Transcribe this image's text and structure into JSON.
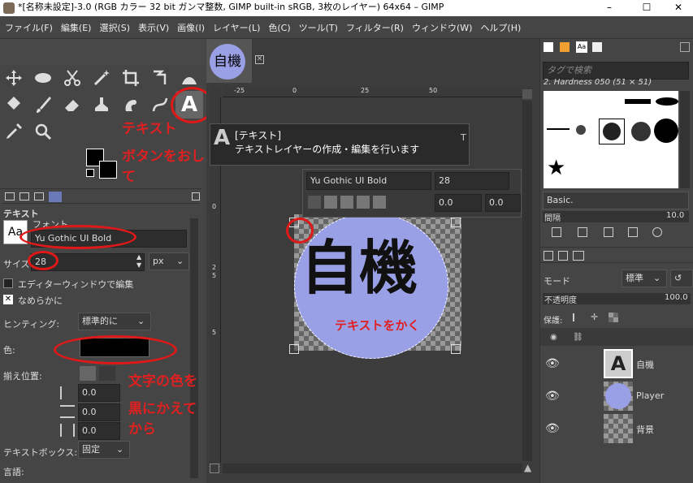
{
  "window": {
    "title": "*[名称未設定]-3.0 (RGB カラー 32 bit ガンマ整数, GIMP built-in sRGB, 3枚のレイヤー) 64x64 – GIMP",
    "minimize": "–",
    "maximize": "☐",
    "close": "✕"
  },
  "menu": [
    "ファイル(F)",
    "編集(E)",
    "選択(S)",
    "表示(V)",
    "画像(I)",
    "レイヤー(L)",
    "色(C)",
    "ツール(T)",
    "フィルター(R)",
    "ウィンドウ(W)",
    "ヘルプ(H)"
  ],
  "annotations": {
    "text_label": "テキスト",
    "press_button": "ボタンをおして",
    "write_text": "テキストをかく",
    "color_note_1": "文字の色を",
    "color_note_2": "黒にかえてから"
  },
  "tool_options": {
    "title": "テキスト",
    "font_label": "フォント",
    "font_value": "Yu Gothic UI Bold",
    "size_label": "サイズ",
    "size_value": "28",
    "unit": "px",
    "editor_label": "エディターウィンドウで編集",
    "antialias_label": "なめらかに",
    "hinting_label": "ヒンティング:",
    "hinting_value": "標準的に",
    "color_label": "色:",
    "justify_label": "揃え位置:",
    "indent": "0.0",
    "line_spacing": "0.0",
    "letter_spacing": "0.0",
    "textbox_label": "テキストボックス:",
    "textbox_value": "固定",
    "language_label": "言語:",
    "aa_icon": "Aa"
  },
  "image_tab": {
    "thumb_text": "自機"
  },
  "ruler": {
    "h": [
      "-25",
      "0",
      "25",
      "50"
    ],
    "v": [
      "0",
      "2",
      "5",
      "5"
    ]
  },
  "tooltip": {
    "icon": "A",
    "title": "[テキスト]",
    "desc": "テキストレイヤーの作成・編集を行います",
    "key": "T"
  },
  "text_toolbar": {
    "font": "Yu Gothic UI Bold",
    "size": "28",
    "baseline": "0.0",
    "kerning": "0.0"
  },
  "canvas": {
    "text": "自機",
    "circle_color": "#9aa0e6"
  },
  "brushes": {
    "tag_placeholder": "タグで検索",
    "name": "2. Hardness 050 (51 × 51)",
    "preset": "Basic.",
    "spacing_label": "間隔",
    "spacing_value": "10.0"
  },
  "layers": {
    "mode_label": "モード",
    "mode_value": "標準",
    "opacity_label": "不透明度",
    "opacity_value": "100.0",
    "lock_label": "保護:",
    "items": [
      {
        "name": "自機"
      },
      {
        "name": "Player"
      },
      {
        "name": "背景"
      }
    ]
  }
}
